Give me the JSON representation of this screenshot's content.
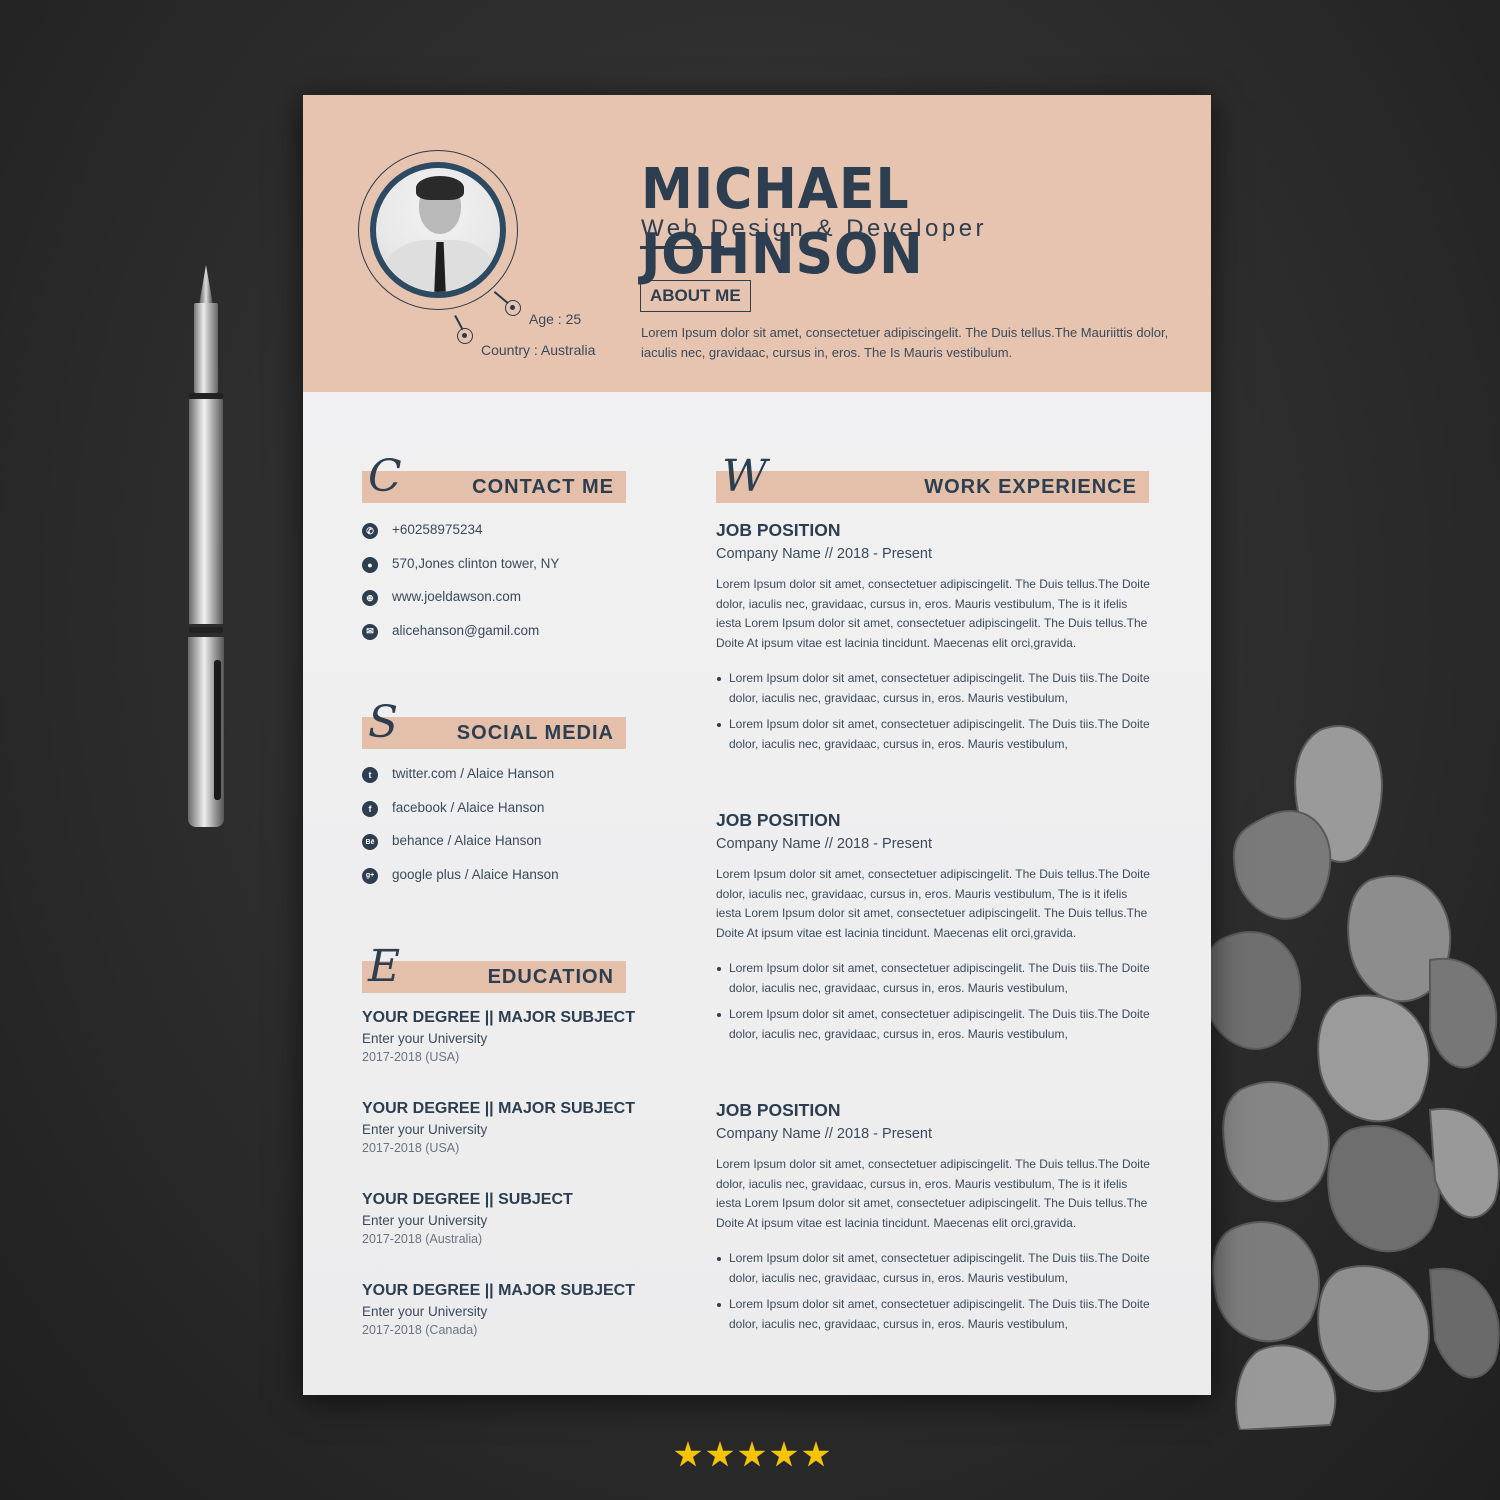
{
  "header": {
    "name": "MICHAEL JOHNSON",
    "role": "Web Design & Developer",
    "age": "Age : 25",
    "country": "Country : Australia",
    "about_label": "ABOUT ME",
    "about_text": "Lorem Ipsum dolor sit amet, consectetuer adipiscingelit. The Duis tellus.The Mauriittis dolor, iaculis nec, gravidaac, cursus in, eros. The Is Mauris vestibulum."
  },
  "contact": {
    "letter": "C",
    "title": "CONTACT ME",
    "items": [
      {
        "icon": "phone-icon",
        "glyph": "✆",
        "text": "+60258975234"
      },
      {
        "icon": "location-icon",
        "glyph": "●",
        "text": "570,Jones clinton tower, NY"
      },
      {
        "icon": "globe-icon",
        "glyph": "⊕",
        "text": "www.joeldawson.com"
      },
      {
        "icon": "mail-icon",
        "glyph": "✉",
        "text": "alicehanson@gamil.com"
      }
    ]
  },
  "social": {
    "letter": "S",
    "title": "SOCIAL MEDIA",
    "items": [
      {
        "icon": "twitter-icon",
        "glyph": "t",
        "text": "twitter.com / Alaice Hanson"
      },
      {
        "icon": "facebook-icon",
        "glyph": "f",
        "text": "facebook / Alaice Hanson"
      },
      {
        "icon": "behance-icon",
        "glyph": "Bē",
        "text": "behance / Alaice Hanson"
      },
      {
        "icon": "google-plus-icon",
        "glyph": "g+",
        "text": "google plus / Alaice Hanson"
      }
    ]
  },
  "education": {
    "letter": "E",
    "title": "EDUCATION",
    "items": [
      {
        "degree": "YOUR DEGREE || MAJOR SUBJECT",
        "university": "Enter your University",
        "years": "2017-2018  (USA)"
      },
      {
        "degree": "YOUR DEGREE || MAJOR SUBJECT",
        "university": "Enter your University",
        "years": "2017-2018  (USA)"
      },
      {
        "degree": "YOUR DEGREE || SUBJECT",
        "university": "Enter your University",
        "years": "2017-2018  (Australia)"
      },
      {
        "degree": "YOUR DEGREE || MAJOR SUBJECT",
        "university": "Enter your University",
        "years": "2017-2018  (Canada)"
      }
    ]
  },
  "work": {
    "letter": "W",
    "title": "WORK EXPERIENCE",
    "jobs": [
      {
        "position": "JOB POSITION",
        "company": "Company Name  //  2018 - Present",
        "description": "Lorem Ipsum dolor sit amet, consectetuer adipiscingelit. The Duis tellus.The  Doite dolor, iaculis nec, gravidaac, cursus in, eros. Mauris vestibulum, The is it ifelis iesta Lorem Ipsum dolor sit amet, consectetuer adipiscingelit. The Duis tellus.The  Doite At ipsum vitae est lacinia tincidunt. Maecenas elit orci,gravida.",
        "bullets": [
          "Lorem Ipsum dolor sit amet, consectetuer adipiscingelit. The Duis tiis.The  Doite dolor, iaculis nec, gravidaac, cursus in, eros. Mauris vestibulum,",
          "Lorem Ipsum dolor sit amet, consectetuer adipiscingelit. The Duis tiis.The  Doite dolor, iaculis nec, gravidaac, cursus in, eros. Mauris vestibulum,"
        ]
      },
      {
        "position": "JOB POSITION",
        "company": "Company Name  //  2018 - Present",
        "description": "Lorem Ipsum dolor sit amet, consectetuer adipiscingelit. The Duis tellus.The  Doite dolor, iaculis nec, gravidaac, cursus in, eros. Mauris vestibulum, The is it ifelis iesta Lorem Ipsum dolor sit amet, consectetuer adipiscingelit. The Duis tellus.The  Doite At ipsum vitae est lacinia tincidunt. Maecenas elit orci,gravida.",
        "bullets": [
          "Lorem Ipsum dolor sit amet, consectetuer adipiscingelit. The Duis tiis.The  Doite dolor, iaculis nec, gravidaac, cursus in, eros. Mauris vestibulum,",
          "Lorem Ipsum dolor sit amet, consectetuer adipiscingelit. The Duis tiis.The  Doite dolor, iaculis nec, gravidaac, cursus in, eros. Mauris vestibulum,"
        ]
      },
      {
        "position": "JOB POSITION",
        "company": "Company Name  //  2018 - Present",
        "description": "Lorem Ipsum dolor sit amet, consectetuer adipiscingelit. The Duis tellus.The  Doite dolor, iaculis nec, gravidaac, cursus in, eros. Mauris vestibulum, The is it ifelis iesta Lorem Ipsum dolor sit amet, consectetuer adipiscingelit. The Duis tellus.The  Doite At ipsum vitae est lacinia tincidunt. Maecenas elit orci,gravida.",
        "bullets": [
          "Lorem Ipsum dolor sit amet, consectetuer adipiscingelit. The Duis tiis.The  Doite dolor, iaculis nec, gravidaac, cursus in, eros. Mauris vestibulum,",
          "Lorem Ipsum dolor sit amet, consectetuer adipiscingelit. The Duis tiis.The  Doite dolor, iaculis nec, gravidaac, cursus in, eros. Mauris vestibulum,"
        ]
      }
    ]
  },
  "rating": {
    "stars": 5,
    "max": 5,
    "color": "#f5c400"
  },
  "colors": {
    "accent": "#e6c4b0",
    "navy": "#2c3e50",
    "desk": "#2c2c2c"
  }
}
